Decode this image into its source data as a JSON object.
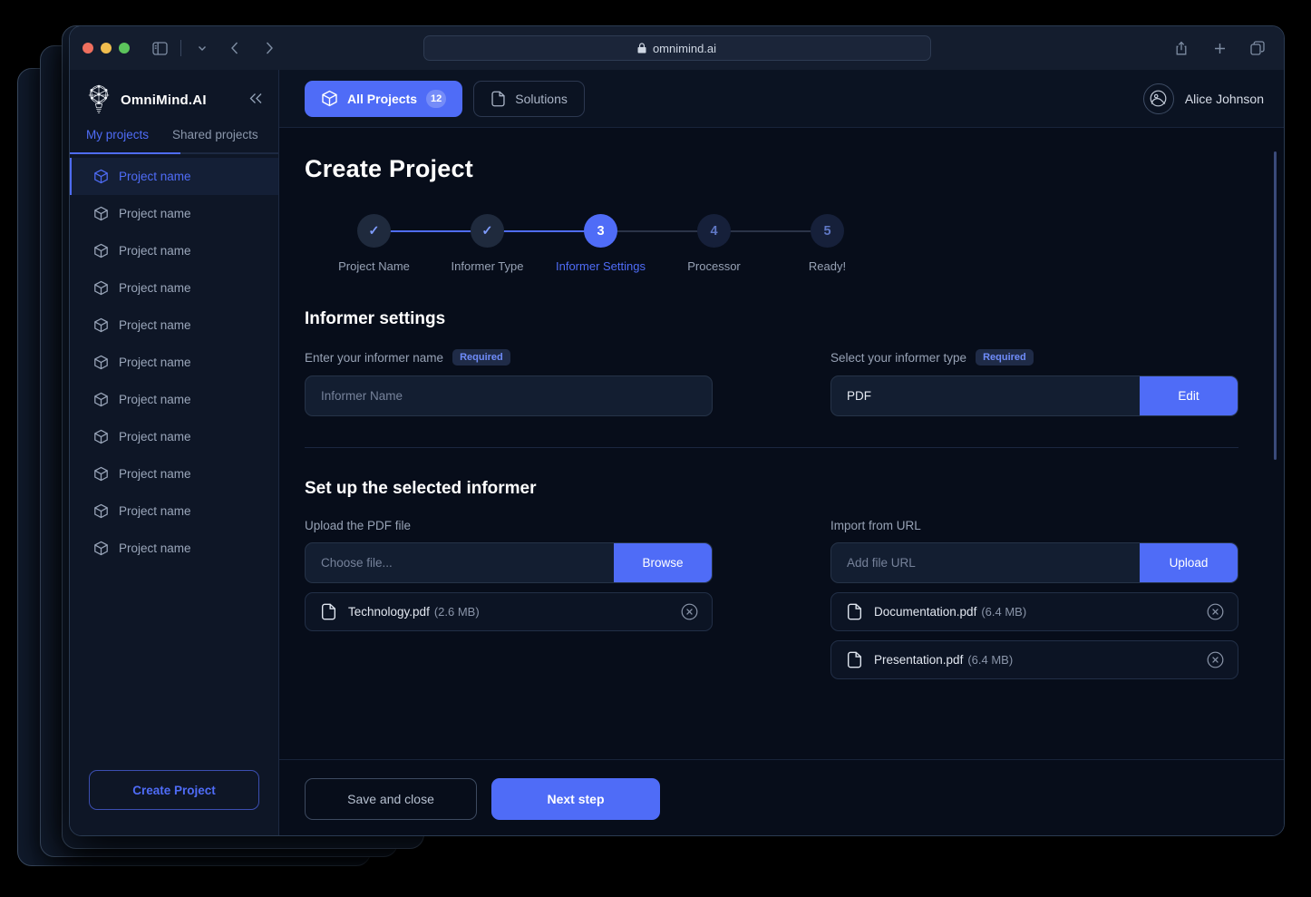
{
  "browser": {
    "url": "omnimind.ai",
    "lock_icon": "lock-icon",
    "traffic_lights": [
      "close",
      "minimize",
      "maximize"
    ],
    "toolbar_icons": [
      "sidebar-toggle-icon",
      "chevron-down-icon",
      "back-arrow-icon",
      "forward-arrow-icon",
      "share-icon",
      "new-tab-icon",
      "tab-overview-icon"
    ]
  },
  "sidebar": {
    "brand": "OmniMind.AI",
    "brand_icon": "lightbulb-network-icon",
    "collapse_icon": "double-chevron-left-icon",
    "tabs": [
      {
        "label": "My projects",
        "active": true
      },
      {
        "label": "Shared projects",
        "active": false
      }
    ],
    "projects": [
      {
        "label": "Project name",
        "active": true
      },
      {
        "label": "Project name",
        "active": false
      },
      {
        "label": "Project name",
        "active": false
      },
      {
        "label": "Project name",
        "active": false
      },
      {
        "label": "Project name",
        "active": false
      },
      {
        "label": "Project name",
        "active": false
      },
      {
        "label": "Project name",
        "active": false
      },
      {
        "label": "Project name",
        "active": false
      },
      {
        "label": "Project name",
        "active": false
      },
      {
        "label": "Project name",
        "active": false
      },
      {
        "label": "Project name",
        "active": false
      }
    ],
    "create_project_label": "Create Project"
  },
  "topbar": {
    "all_projects_label": "All Projects",
    "all_projects_count": "12",
    "all_projects_icon": "cube-icon",
    "solutions_label": "Solutions",
    "solutions_icon": "page-icon",
    "user_name": "Alice Johnson",
    "avatar_icon": "user-avatar-icon"
  },
  "main": {
    "page_title": "Create Project",
    "stepper": [
      {
        "num": "1",
        "label": "Project Name",
        "state": "done",
        "mark": "✓"
      },
      {
        "num": "2",
        "label": "Informer Type",
        "state": "done",
        "mark": "✓"
      },
      {
        "num": "3",
        "label": "Informer Settings",
        "state": "current",
        "mark": "3"
      },
      {
        "num": "4",
        "label": "Processor",
        "state": "todo",
        "mark": "4"
      },
      {
        "num": "5",
        "label": "Ready!",
        "state": "todo",
        "mark": "5"
      }
    ],
    "informer_settings": {
      "section_title": "Informer settings",
      "name_field": {
        "label": "Enter your informer name",
        "badge": "Required",
        "placeholder": "Informer Name",
        "value": ""
      },
      "type_field": {
        "label": "Select your informer type",
        "badge": "Required",
        "value": "PDF",
        "action": "Edit"
      }
    },
    "setup": {
      "section_title": "Set up the selected informer",
      "upload": {
        "label": "Upload the PDF file",
        "placeholder": "Choose file...",
        "action": "Browse",
        "files": [
          {
            "name": "Technology.pdf",
            "size": "(2.6 MB)",
            "icon": "file-icon",
            "remove_icon": "close-circle-icon"
          }
        ]
      },
      "import": {
        "label": "Import from URL",
        "placeholder": "Add file URL",
        "action": "Upload",
        "files": [
          {
            "name": "Documentation.pdf",
            "size": "(6.4 MB)",
            "icon": "file-icon",
            "remove_icon": "close-circle-icon"
          },
          {
            "name": "Presentation.pdf",
            "size": "(6.4 MB)",
            "icon": "file-icon",
            "remove_icon": "close-circle-icon"
          }
        ]
      }
    }
  },
  "footer": {
    "save_close_label": "Save and close",
    "next_step_label": "Next step"
  },
  "colors": {
    "accent": "#4f6cf7",
    "app_bg": "#070d1a",
    "sidebar_bg": "#0e1626",
    "panel_bg": "#0b1322",
    "input_bg": "#131e31"
  }
}
